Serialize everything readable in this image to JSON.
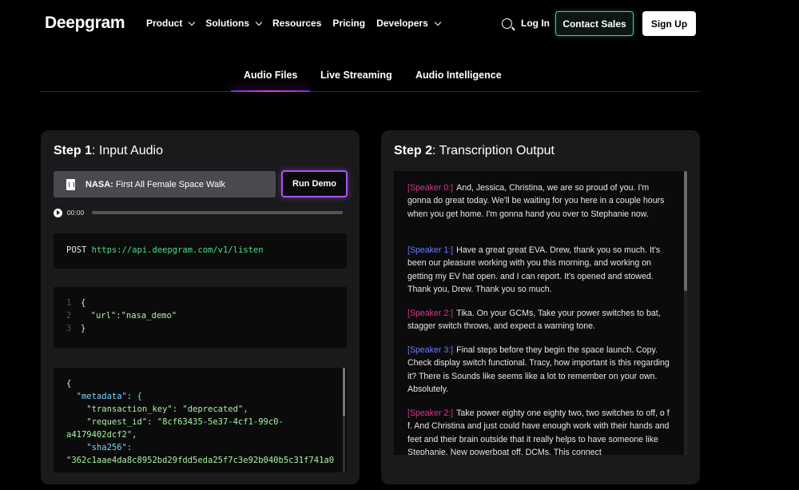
{
  "brand": {
    "logo": "Deepgram"
  },
  "nav": {
    "items": [
      {
        "label": "Product",
        "dropdown": true
      },
      {
        "label": "Solutions",
        "dropdown": true
      },
      {
        "label": "Resources",
        "dropdown": false
      },
      {
        "label": "Pricing",
        "dropdown": false
      },
      {
        "label": "Developers",
        "dropdown": true
      }
    ],
    "login": "Log In",
    "contact": "Contact Sales",
    "signup": "Sign Up"
  },
  "tabs": [
    {
      "label": "Audio Files",
      "active": true
    },
    {
      "label": "Live Streaming",
      "active": false
    },
    {
      "label": "Audio Intelligence",
      "active": false
    }
  ],
  "step1": {
    "title_bold": "Step 1",
    "title_rest": ": Input Audio",
    "file_source": "NASA:",
    "file_name": " First All Female Space Walk",
    "run_button": "Run Demo",
    "time": "00:00",
    "request_method": "POST",
    "request_url": "https://api.deepgram.com/v1/listen",
    "body_lines": [
      "{",
      "  \"url\":\"nasa_demo\"",
      "}"
    ],
    "response_lines": [
      "{",
      "  \"metadata\": {",
      "    \"transaction_key\": \"deprecated\",",
      "    \"request_id\": \"8cf63435-5e37-4cf1-99c0-",
      "a4179402dcf2\",",
      "    \"sha256\":",
      "\"362c1aae4da8c8952bd29fdd5eda25f7c3e92b040b5c31f741a0"
    ]
  },
  "step2": {
    "title_bold": "Step 2",
    "title_rest": ": Transcription Output",
    "segments": [
      {
        "speaker": "[Speaker 0:]",
        "color": "#e0338a",
        "text": "And, Jessica, Christina, we are so proud of you. I'm gonna do great today. We'll be waiting for you here in a couple hours when you get home. I'm gonna hand you over to Stephanie now."
      },
      {
        "speaker": "[Speaker 1:]",
        "color": "#6b7cff",
        "text": "Have a great great EVA. Drew, thank you so much. It's been our pleasure working with you this morning, and working on getting my EV hat open. and I can report. It's opened and stowed. Thank you, Drew. Thank you so much."
      },
      {
        "speaker": "[Speaker 2:]",
        "color": "#e0338a",
        "text": "Tika. On your GCMs, Take your power switches to bat, stagger switch throws, and expect a warning tone."
      },
      {
        "speaker": "[Speaker 3:]",
        "color": "#6b7cff",
        "text": "Final steps before they begin the space launch. Copy. Check display switch functional. Tracy, how important is this regarding it? There is Sounds like seems like a lot to remember on your own. Absolutely."
      },
      {
        "speaker": "[Speaker 2:]",
        "color": "#e0338a",
        "text": "Take power eighty one eighty two, two switches to off, o f f. And Christina and just could have enough work with their hands and feet and their brain outside that it really helps to have someone like Stephanie. New powerboat off. DCMs. This connect"
      }
    ]
  },
  "colors": {
    "accent_purple": "#a855f7",
    "accent_teal": "#38d0b6"
  }
}
